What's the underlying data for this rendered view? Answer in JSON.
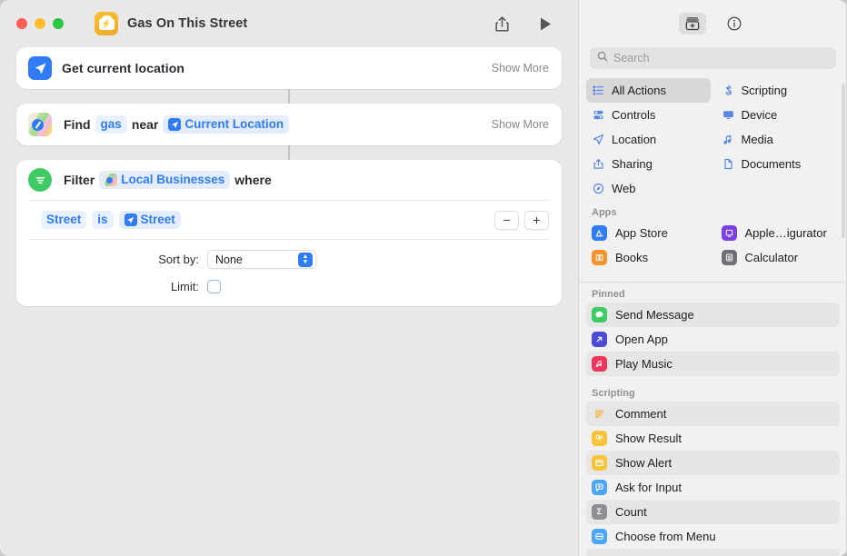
{
  "window": {
    "title": "Gas On This Street",
    "app_icon_name": "shortcuts-car-icon",
    "share_label": "Share",
    "run_label": "Run"
  },
  "editor": {
    "actions": [
      {
        "id": "get-current-location",
        "icon": "location-arrow-icon",
        "label": "Get current location",
        "show_more": "Show More"
      },
      {
        "id": "find-places",
        "icon": "maps-icon",
        "prefix": "Find",
        "query": "gas",
        "mid": "near",
        "variable": "Current Location",
        "show_more": "Show More"
      },
      {
        "id": "filter-files",
        "icon": "filter-icon",
        "prefix": "Filter",
        "input": "Local Businesses",
        "suffix": "where",
        "condition": {
          "field": "Street",
          "operator": "is",
          "value": "Street"
        },
        "remove_label": "−",
        "add_label": "+",
        "sort_label": "Sort by:",
        "sort_value": "None",
        "limit_label": "Limit:",
        "limit_checked": false
      }
    ]
  },
  "library": {
    "tabs": [
      {
        "name": "action-library-tab",
        "icon": "library-icon",
        "selected": true
      },
      {
        "name": "info-tab",
        "icon": "info-circle-icon",
        "selected": false
      }
    ],
    "search": {
      "placeholder": "Search",
      "value": "",
      "icon": "search-icon"
    },
    "categories": [
      {
        "label": "All Actions",
        "icon": "list-icon",
        "selected": true
      },
      {
        "label": "Scripting",
        "icon": "scripting-icon",
        "selected": false
      },
      {
        "label": "Controls",
        "icon": "controls-icon",
        "selected": false
      },
      {
        "label": "Device",
        "icon": "device-icon",
        "selected": false
      },
      {
        "label": "Location",
        "icon": "location-arrow-icon",
        "selected": false
      },
      {
        "label": "Media",
        "icon": "music-note-icon",
        "selected": false
      },
      {
        "label": "Sharing",
        "icon": "share-icon",
        "selected": false
      },
      {
        "label": "Documents",
        "icon": "document-icon",
        "selected": false
      },
      {
        "label": "Web",
        "icon": "compass-icon",
        "selected": false
      }
    ],
    "sections": [
      {
        "title": "Apps",
        "layout": "grid",
        "items": [
          {
            "label": "App Store",
            "icon": "app-store-icon",
            "color": "#2f7cf6"
          },
          {
            "label": "Apple…igurator",
            "icon": "apple-configurator-icon",
            "color": "#7b3fe4"
          },
          {
            "label": "Books",
            "icon": "books-icon",
            "color": "#f5942c"
          },
          {
            "label": "Calculator",
            "icon": "calculator-icon",
            "color": "#6f6f75"
          }
        ]
      },
      {
        "title": "Pinned",
        "layout": "list",
        "items": [
          {
            "label": "Send Message",
            "icon": "messages-icon",
            "color": "#3ecb63"
          },
          {
            "label": "Open App",
            "icon": "open-app-icon",
            "color": "#4b4bd6"
          },
          {
            "label": "Play Music",
            "icon": "music-icon",
            "color": "#f0355a"
          }
        ]
      },
      {
        "title": "Scripting",
        "layout": "list",
        "items": [
          {
            "label": "Comment",
            "icon": "comment-icon",
            "color": "#f5a623"
          },
          {
            "label": "Show Result",
            "icon": "show-result-icon",
            "color": "#f8c43c"
          },
          {
            "label": "Show Alert",
            "icon": "show-alert-icon",
            "color": "#f8c43c"
          },
          {
            "label": "Ask for Input",
            "icon": "ask-input-icon",
            "color": "#4da6f5"
          },
          {
            "label": "Count",
            "icon": "count-icon",
            "color": "#8e8e93"
          },
          {
            "label": "Choose from Menu",
            "icon": "choose-menu-icon",
            "color": "#4da6f5"
          }
        ]
      }
    ]
  },
  "colors": {
    "accent": "#2f7cf6",
    "window_bg": "#e8e8e8",
    "sidebar_bg": "#f1f1f1",
    "card_bg": "#ffffff",
    "chip_bg": "#e9f0fe"
  }
}
